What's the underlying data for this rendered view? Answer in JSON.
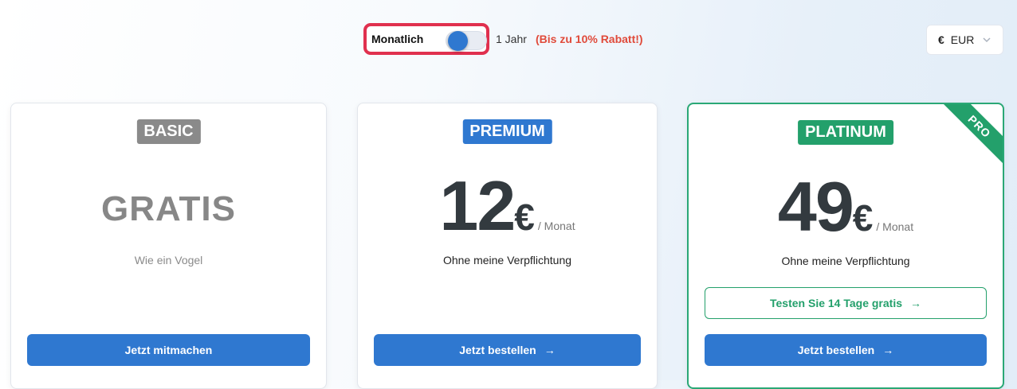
{
  "billing": {
    "monthly_label": "Monatlich",
    "yearly_label": "1 Jahr",
    "discount_label": "(Bis zu 10% Rabatt!)",
    "selected": "monthly"
  },
  "currency": {
    "symbol": "€",
    "code": "EUR"
  },
  "plans": [
    {
      "badge": "BASIC",
      "price_label": "GRATIS",
      "subtitle": "Wie ein Vogel",
      "primary_button": "Jetzt mitmachen",
      "badge_color": "#8a8a8a"
    },
    {
      "badge": "PREMIUM",
      "amount": "12",
      "currency": "€",
      "period": "/ Monat",
      "subtitle": "Ohne meine Verpflichtung",
      "primary_button": "Jetzt bestellen",
      "button_icon": "arrow-right-icon",
      "badge_color": "#2f78d0"
    },
    {
      "badge": "PLATINUM",
      "ribbon": "PRO",
      "amount": "49",
      "currency": "€",
      "period": "/ Monat",
      "subtitle": "Ohne meine Verpflichtung",
      "trial_button": "Testen Sie 14 Tage gratis",
      "primary_button": "Jetzt bestellen",
      "button_icon": "arrow-right-icon",
      "badge_color": "#23a06b"
    }
  ],
  "colors": {
    "accent_blue": "#2f78d0",
    "accent_green": "#23a06b",
    "highlight_red": "#e0304e",
    "discount_red": "#e04a3a"
  }
}
